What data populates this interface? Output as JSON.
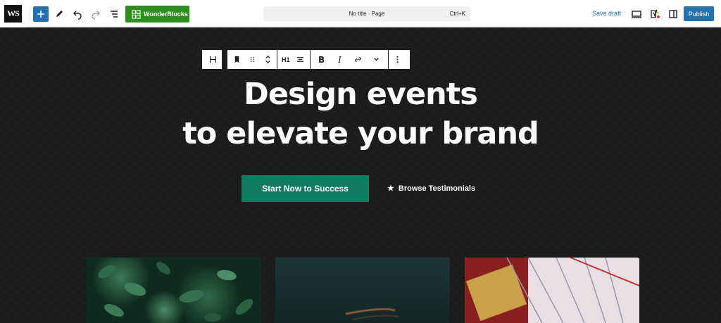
{
  "app": {
    "logo_text": "WS"
  },
  "toolbar": {
    "wonderblocks_label": "WonderBlocks",
    "command_title": "No title · Page",
    "command_shortcut": "Ctrl+K",
    "save_draft": "Save draft",
    "publish": "Publish",
    "accent_color": "#2271b1",
    "wonderblocks_color": "#2d8f1e"
  },
  "block_toolbar": {
    "heading_level": "H1"
  },
  "hero": {
    "title_line1": "Design events",
    "title_line2": "to elevate your brand",
    "cta_label": "Start Now to Success",
    "cta_color": "#0f7b63",
    "secondary_label": "Browse Testimonials",
    "secondary_icon": "star-icon"
  }
}
